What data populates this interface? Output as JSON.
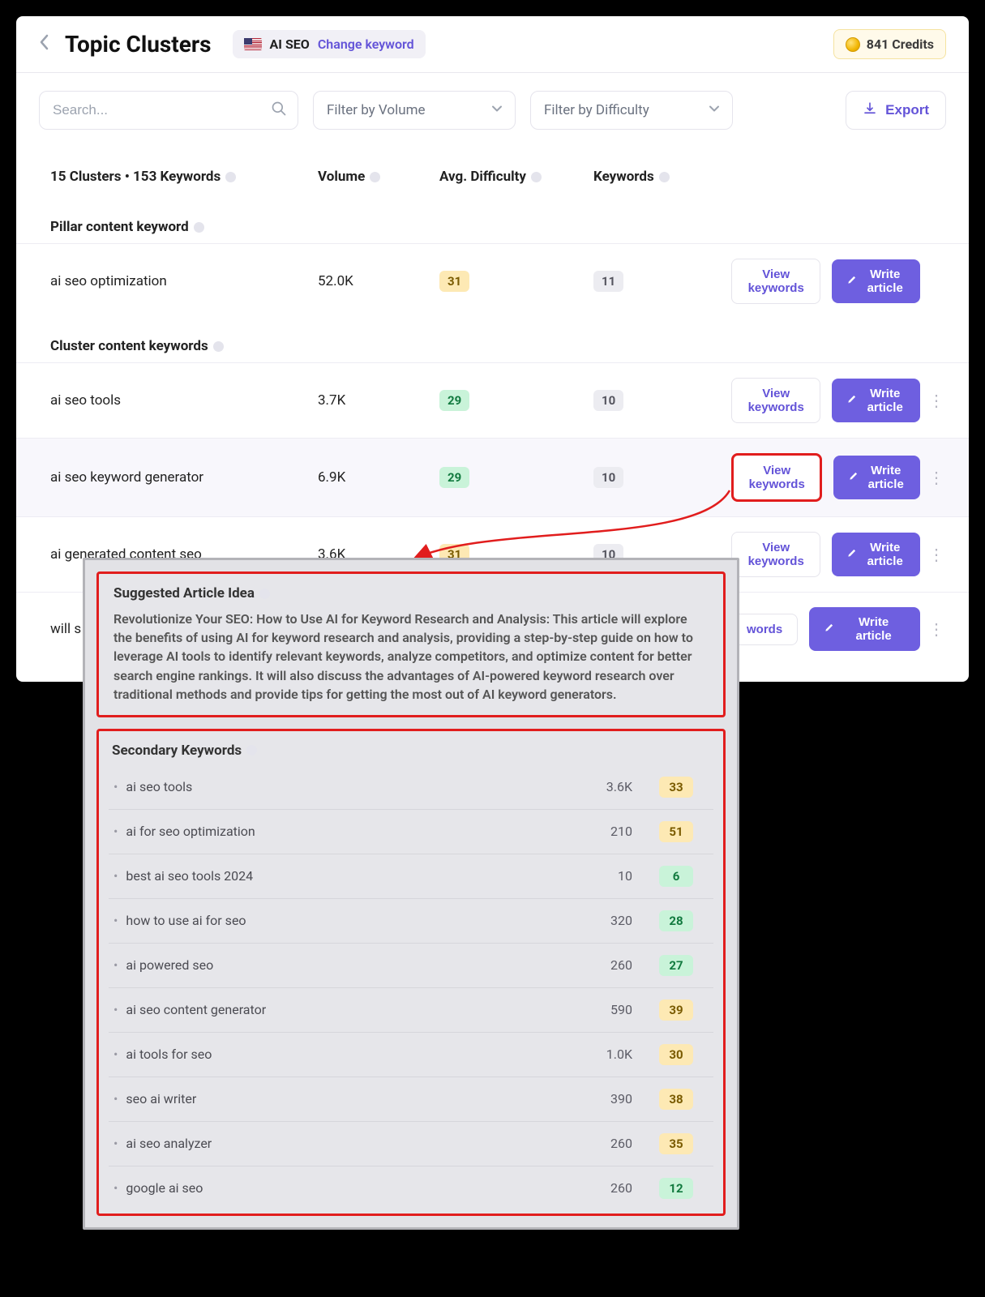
{
  "header": {
    "title": "Topic Clusters",
    "keyword": "AI SEO",
    "change_label": "Change keyword",
    "credits_label": "841 Credits"
  },
  "toolbar": {
    "search_placeholder": "Search...",
    "volume_filter": "Filter by Volume",
    "difficulty_filter": "Filter by Difficulty",
    "export_label": "Export"
  },
  "columns": {
    "summary": "15 Clusters • 153 Keywords",
    "volume": "Volume",
    "difficulty": "Avg. Difficulty",
    "keywords": "Keywords"
  },
  "sections": {
    "pillar": "Pillar content keyword",
    "cluster": "Cluster content keywords"
  },
  "buttons": {
    "view": "View keywords",
    "write": "Write article"
  },
  "pillar_row": {
    "keyword": "ai seo optimization",
    "volume": "52.0K",
    "difficulty": "31",
    "diff_cls": "yellow",
    "kw_count": "11"
  },
  "cluster_rows": [
    {
      "keyword": "ai seo tools",
      "volume": "3.7K",
      "difficulty": "29",
      "diff_cls": "green",
      "kw_count": "10",
      "highlight": false,
      "view_red": false
    },
    {
      "keyword": "ai seo keyword generator",
      "volume": "6.9K",
      "difficulty": "29",
      "diff_cls": "green",
      "kw_count": "10",
      "highlight": true,
      "view_red": true
    },
    {
      "keyword": "ai generated content seo",
      "volume": "3.6K",
      "difficulty": "31",
      "diff_cls": "yellow",
      "kw_count": "10",
      "highlight": false,
      "view_red": false
    },
    {
      "keyword": "will s",
      "volume": "",
      "difficulty": "",
      "diff_cls": "",
      "kw_count": "",
      "highlight": false,
      "view_red": false,
      "partial_view": "words"
    }
  ],
  "popup": {
    "idea_title": "Suggested Article Idea",
    "idea_body": "Revolutionize Your SEO: How to Use AI for Keyword Research and Analysis: This article will explore the benefits of using AI for keyword research and analysis, providing a step-by-step guide on how to leverage AI tools to identify relevant keywords, analyze competitors, and optimize content for better search engine rankings. It will also discuss the advantages of AI-powered keyword research over traditional methods and provide tips for getting the most out of AI keyword generators.",
    "secondary_title": "Secondary Keywords",
    "secondary": [
      {
        "kw": "ai seo tools",
        "vol": "3.6K",
        "diff": "33",
        "cls": "yellow"
      },
      {
        "kw": "ai for seo optimization",
        "vol": "210",
        "diff": "51",
        "cls": "yellow"
      },
      {
        "kw": "best ai seo tools 2024",
        "vol": "10",
        "diff": "6",
        "cls": "green"
      },
      {
        "kw": "how to use ai for seo",
        "vol": "320",
        "diff": "28",
        "cls": "green"
      },
      {
        "kw": "ai powered seo",
        "vol": "260",
        "diff": "27",
        "cls": "green"
      },
      {
        "kw": "ai seo content generator",
        "vol": "590",
        "diff": "39",
        "cls": "yellow"
      },
      {
        "kw": "ai tools for seo",
        "vol": "1.0K",
        "diff": "30",
        "cls": "yellow"
      },
      {
        "kw": "seo ai writer",
        "vol": "390",
        "diff": "38",
        "cls": "yellow"
      },
      {
        "kw": "ai seo analyzer",
        "vol": "260",
        "diff": "35",
        "cls": "yellow"
      },
      {
        "kw": "google ai seo",
        "vol": "260",
        "diff": "12",
        "cls": "green"
      }
    ]
  }
}
